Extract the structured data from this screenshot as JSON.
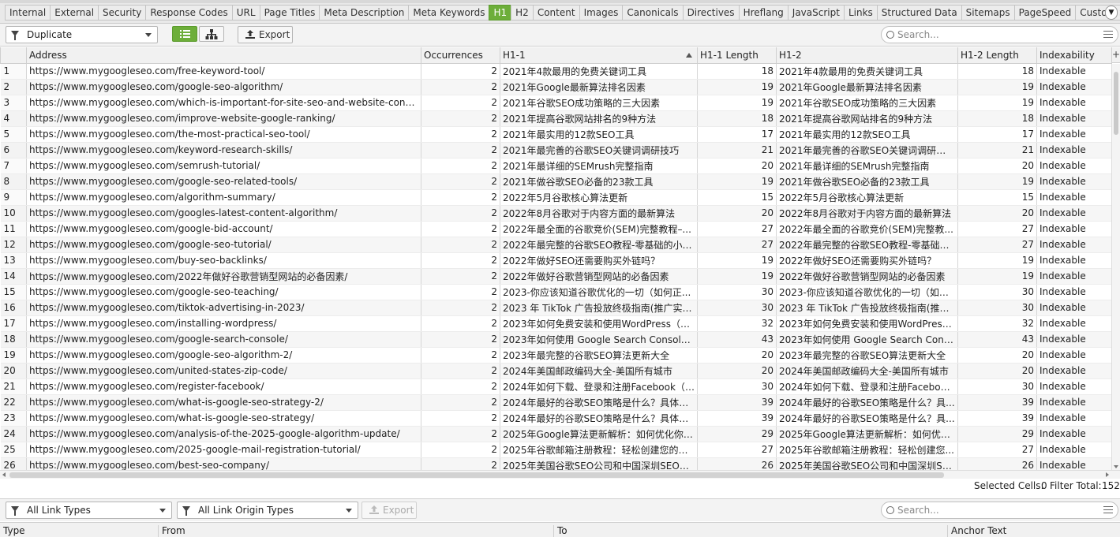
{
  "tabs": [
    "Internal",
    "External",
    "Security",
    "Response Codes",
    "URL",
    "Page Titles",
    "Meta Description",
    "Meta Keywords",
    "H1",
    "H2",
    "Content",
    "Images",
    "Canonicals",
    "Directives",
    "Hreflang",
    "JavaScript",
    "Links",
    "Structured Data",
    "Sitemaps",
    "PageSpeed",
    "Custom Search",
    "C"
  ],
  "active_tab": "H1",
  "toolbar": {
    "filter_value": "Duplicate",
    "export_label": "Export",
    "search_placeholder": "Search..."
  },
  "columns": [
    "",
    "Address",
    "Occurrences",
    "H1-1",
    "H1-1 Length",
    "H1-2",
    "H1-2 Length",
    "Indexability"
  ],
  "rows": [
    [
      "1",
      "https://www.mygoogleseo.com/free-keyword-tool/",
      "2",
      "2021年4款最用的免费关键词工具",
      "18",
      "2021年4款最用的免费关键词工具",
      "18",
      "Indexable"
    ],
    [
      "2",
      "https://www.mygoogleseo.com/google-seo-algorithm/",
      "2",
      "2021年Google最新算法排名因素",
      "19",
      "2021年Google最新算法排名因素",
      "19",
      "Indexable"
    ],
    [
      "3",
      "https://www.mygoogleseo.com/which-is-important-for-site-seo-and-website-content/",
      "2",
      "2021年谷歌SEO成功策略的三大因素",
      "19",
      "2021年谷歌SEO成功策略的三大因素",
      "19",
      "Indexable"
    ],
    [
      "4",
      "https://www.mygoogleseo.com/improve-website-google-ranking/",
      "2",
      "2021年提高谷歌网站排名的9种方法",
      "18",
      "2021年提高谷歌网站排名的9种方法",
      "18",
      "Indexable"
    ],
    [
      "5",
      "https://www.mygoogleseo.com/the-most-practical-seo-tool/",
      "2",
      "2021年最实用的12款SEO工具",
      "17",
      "2021年最实用的12款SEO工具",
      "17",
      "Indexable"
    ],
    [
      "6",
      "https://www.mygoogleseo.com/keyword-research-skills/",
      "2",
      "2021年最完善的谷歌SEO关键词调研技巧",
      "21",
      "2021年最完善的谷歌SEO关键词调研技巧",
      "21",
      "Indexable"
    ],
    [
      "7",
      "https://www.mygoogleseo.com/semrush-tutorial/",
      "2",
      "2021年最详细的SEMrush完整指南",
      "20",
      "2021年最详细的SEMrush完整指南",
      "20",
      "Indexable"
    ],
    [
      "8",
      "https://www.mygoogleseo.com/google-seo-related-tools/",
      "2",
      "2021年做谷歌SEO必备的23款工具",
      "19",
      "2021年做谷歌SEO必备的23款工具",
      "19",
      "Indexable"
    ],
    [
      "9",
      "https://www.mygoogleseo.com/algorithm-summary/",
      "2",
      "2022年5月谷歌核心算法更新",
      "15",
      "2022年5月谷歌核心算法更新",
      "15",
      "Indexable"
    ],
    [
      "10",
      "https://www.mygoogleseo.com/googles-latest-content-algorithm/",
      "2",
      "2022年8月谷歌对于内容方面的最新算法",
      "20",
      "2022年8月谷歌对于内容方面的最新算法",
      "20",
      "Indexable"
    ],
    [
      "11",
      "https://www.mygoogleseo.com/google-bid-account/",
      "2",
      "2022年最全面的谷歌竞价(SEM)完整教程–...",
      "27",
      "2022年最全面的谷歌竞价(SEM)完整教...",
      "27",
      "Indexable"
    ],
    [
      "12",
      "https://www.mygoogleseo.com/google-seo-tutorial/",
      "2",
      "2022年最完整的谷歌SEO教程-零基础的小白...",
      "27",
      "2022年最完整的谷歌SEO教程-零基础的...",
      "27",
      "Indexable"
    ],
    [
      "13",
      "https://www.mygoogleseo.com/buy-seo-backlinks/",
      "2",
      "2022年做好SEO还需要购买外链吗？",
      "19",
      "2022年做好SEO还需要购买外链吗？",
      "19",
      "Indexable"
    ],
    [
      "14",
      "https://www.mygoogleseo.com/2022年做好谷歌营销型网站的必备因素/",
      "2",
      "2022年做好谷歌营销型网站的必备因素",
      "19",
      "2022年做好谷歌营销型网站的必备因素",
      "19",
      "Indexable"
    ],
    [
      "15",
      "https://www.mygoogleseo.com/google-seo-teaching/",
      "2",
      "2023-你应该知道谷歌优化的一切（如何正...",
      "30",
      "2023-你应该知道谷歌优化的一切（如何...",
      "30",
      "Indexable"
    ],
    [
      "16",
      "https://www.mygoogleseo.com/tiktok-advertising-in-2023/",
      "2",
      "2023 年 TikTok 广告投放终极指南(推广实操...",
      "30",
      "2023 年 TikTok 广告投放终极指南(推广...",
      "30",
      "Indexable"
    ],
    [
      "17",
      "https://www.mygoogleseo.com/installing-wordpress/",
      "2",
      "2023年如何免费安装和使用WordPress（B2...",
      "32",
      "2023年如何免费安装和使用WordPress...",
      "32",
      "Indexable"
    ],
    [
      "18",
      "https://www.mygoogleseo.com/google-search-console/",
      "2",
      "2023年如何使用 Google Search Console（...",
      "43",
      "2023年如何使用 Google Search Consol...",
      "43",
      "Indexable"
    ],
    [
      "19",
      "https://www.mygoogleseo.com/google-seo-algorithm-2/",
      "2",
      "2023年最完整的谷歌SEO算法更新大全",
      "20",
      "2023年最完整的谷歌SEO算法更新大全",
      "20",
      "Indexable"
    ],
    [
      "20",
      "https://www.mygoogleseo.com/united-states-zip-code/",
      "2",
      "2024年美国邮政编码大全-美国所有城市",
      "20",
      "2024年美国邮政编码大全-美国所有城市",
      "20",
      "Indexable"
    ],
    [
      "21",
      "https://www.mygoogleseo.com/register-facebook/",
      "2",
      "2024年如何下载、登录和注册Facebook（F...",
      "30",
      "2024年如何下载、登录和注册Facebook...",
      "30",
      "Indexable"
    ],
    [
      "22",
      "https://www.mygoogleseo.com/what-is-google-seo-strategy-2/",
      "2",
      "2024年最好的谷歌SEO策略是什么？具体应...",
      "39",
      "2024年最好的谷歌SEO策略是什么？具...",
      "39",
      "Indexable"
    ],
    [
      "23",
      "https://www.mygoogleseo.com/what-is-google-seo-strategy/",
      "2",
      "2024年最好的谷歌SEO策略是什么？具体应...",
      "39",
      "2024年最好的谷歌SEO策略是什么？具...",
      "39",
      "Indexable"
    ],
    [
      "24",
      "https://www.mygoogleseo.com/analysis-of-the-2025-google-algorithm-update/",
      "2",
      "2025年Google算法更新解析：如何优化你的...",
      "29",
      "2025年Google算法更新解析：如何优化...",
      "29",
      "Indexable"
    ],
    [
      "25",
      "https://www.mygoogleseo.com/2025-google-mail-registration-tutorial/",
      "2",
      "2025年谷歌邮箱注册教程：轻松创建您的G...",
      "27",
      "2025年谷歌邮箱注册教程：轻松创建您...",
      "27",
      "Indexable"
    ],
    [
      "26",
      "https://www.mygoogleseo.com/best-seo-company/",
      "2",
      "2025年美国谷歌SEO公司和中国深圳SEO公...",
      "26",
      "2025年美国谷歌SEO公司和中国深圳SE...",
      "26",
      "Indexable"
    ]
  ],
  "status": {
    "selected_label": "Selected Cells:",
    "selected_value": "0",
    "filter_label": "Filter Total:",
    "filter_value": "152"
  },
  "lower": {
    "link_types": "All Link Types",
    "link_origin_types": "All Link Origin Types",
    "export_label": "Export",
    "search_placeholder": "Search...",
    "columns": [
      "Type",
      "From",
      "To",
      "Anchor Text"
    ]
  }
}
